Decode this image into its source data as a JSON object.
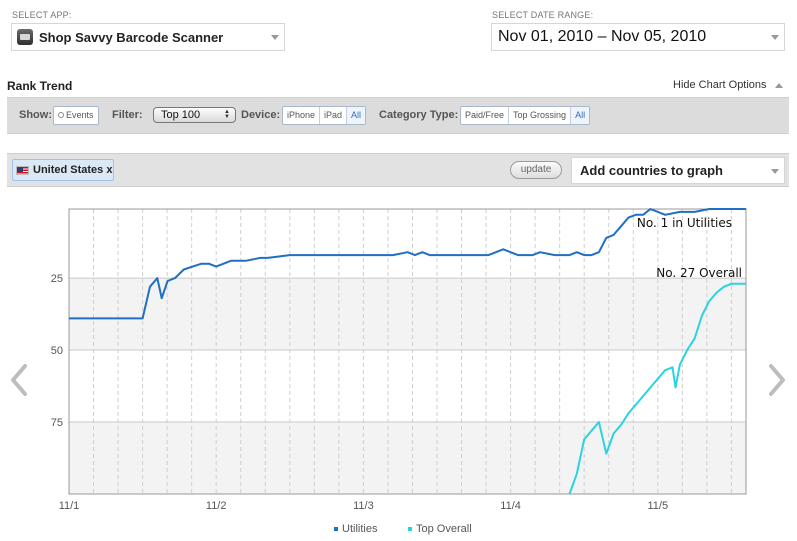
{
  "select_app": {
    "label": "SELECT APP:",
    "value": "Shop Savvy Barcode Scanner"
  },
  "select_date": {
    "label": "SELECT DATE RANGE:",
    "value": "Nov 01, 2010 – Nov 05, 2010"
  },
  "rank_trend": {
    "title": "Rank Trend",
    "hide_options": "Hide Chart Options"
  },
  "options_bar": {
    "show_label": "Show:",
    "events_label": "Events",
    "filter_label": "Filter:",
    "filter_value": "Top 100",
    "device_label": "Device:",
    "devices": [
      "iPhone",
      "iPad",
      "All"
    ],
    "device_selected": "All",
    "category_label": "Category Type:",
    "categories": [
      "Paid/Free",
      "Top Grossing",
      "All"
    ],
    "category_selected": "All"
  },
  "country_bar": {
    "country": "United States x",
    "update_label": "update",
    "add_countries_placeholder": "Add countries to graph"
  },
  "colors": {
    "utilities": "#1f6fc4",
    "top_overall": "#2ad3e0"
  },
  "icons": {
    "left_nav": "chevron-left-icon",
    "right_nav": "chevron-right-icon",
    "flag": "us-flag-icon",
    "app": "app-icon"
  },
  "chart_data": {
    "type": "line",
    "x_tick_labels": [
      "11/1",
      "11/2",
      "11/3",
      "11/4",
      "11/5"
    ],
    "y_tick_labels": [
      "25",
      "50",
      "75"
    ],
    "ylim": [
      100,
      1
    ],
    "y_reversed": true,
    "x_range": [
      0,
      4.6
    ],
    "grid": true,
    "legend_position": "bottom",
    "annotations": [
      {
        "text": "No. 1 in Utilities",
        "series": "Utilities"
      },
      {
        "text": "No. 27 Overall",
        "series": "Top Overall"
      }
    ],
    "series": [
      {
        "name": "Utilities",
        "x": [
          0,
          0.5,
          0.55,
          0.6,
          0.63,
          0.67,
          0.72,
          0.78,
          0.84,
          0.9,
          0.95,
          1.0,
          1.1,
          1.2,
          1.3,
          1.35,
          1.5,
          1.6,
          1.7,
          1.8,
          1.9,
          2.0,
          2.1,
          2.2,
          2.3,
          2.35,
          2.4,
          2.45,
          2.55,
          2.65,
          2.75,
          2.85,
          2.9,
          2.95,
          3.05,
          3.1,
          3.15,
          3.2,
          3.3,
          3.35,
          3.4,
          3.45,
          3.5,
          3.55,
          3.6,
          3.65,
          3.7,
          3.75,
          3.8,
          3.85,
          3.9,
          3.95,
          4.05,
          4.15,
          4.25,
          4.35,
          4.45,
          4.6
        ],
        "y": [
          39,
          39,
          28,
          25,
          32,
          26,
          25,
          22,
          21,
          20,
          20,
          21,
          19,
          19,
          18,
          18,
          17,
          17,
          17,
          17,
          17,
          17,
          17,
          17,
          16,
          17,
          16,
          17,
          17,
          17,
          17,
          17,
          16,
          15,
          17,
          17,
          17,
          16,
          17,
          17,
          17,
          16,
          17,
          17,
          16,
          11,
          10,
          7,
          4,
          3,
          3,
          1,
          3,
          2,
          2,
          1,
          1,
          1
        ]
      },
      {
        "name": "Top Overall",
        "x": [
          3.4,
          3.45,
          3.5,
          3.55,
          3.6,
          3.65,
          3.7,
          3.75,
          3.8,
          3.85,
          3.9,
          3.95,
          4.0,
          4.05,
          4.1,
          4.12,
          4.15,
          4.2,
          4.25,
          4.3,
          4.35,
          4.4,
          4.45,
          4.5,
          4.6
        ],
        "y": [
          100,
          93,
          81,
          78,
          75,
          86,
          79,
          76,
          72,
          69,
          66,
          63,
          60,
          57,
          56,
          63,
          55,
          50,
          46,
          38,
          33,
          30,
          28,
          27,
          27
        ]
      }
    ]
  },
  "legend": {
    "utilities": "Utilities",
    "top_overall": "Top Overall"
  }
}
